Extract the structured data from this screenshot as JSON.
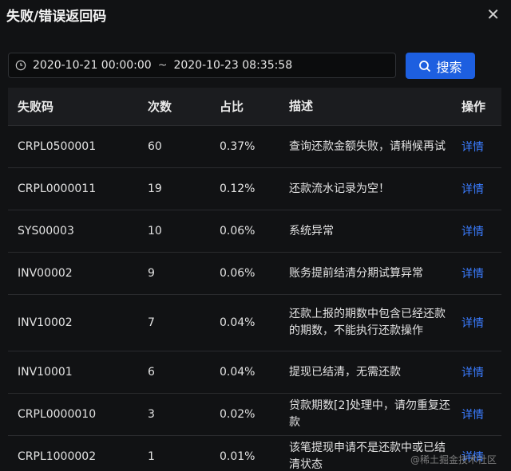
{
  "dialog": {
    "title": "失败/错误返回码",
    "close_icon": "close-icon"
  },
  "filter": {
    "start": "2020-10-21 00:00:00",
    "separator": "~",
    "end": "2020-10-23 08:35:58",
    "search_label": "搜索",
    "search_color": "#1d5fe0"
  },
  "table": {
    "headers": [
      "失败码",
      "次数",
      "占比",
      "描述",
      "操作"
    ],
    "rows": [
      {
        "code": "CRPL0500001",
        "count": "60",
        "ratio": "0.37%",
        "desc": "查询还款金额失败，请稍候再试",
        "action": "详情"
      },
      {
        "code": "CRPL0000011",
        "count": "19",
        "ratio": "0.12%",
        "desc": "还款流水记录为空！",
        "action": "详情"
      },
      {
        "code": "SYS00003",
        "count": "10",
        "ratio": "0.06%",
        "desc": "系统异常",
        "action": "详情"
      },
      {
        "code": "INV00002",
        "count": "9",
        "ratio": "0.06%",
        "desc": "账务提前结清分期试算异常",
        "action": "详情"
      },
      {
        "code": "INV10002",
        "count": "7",
        "ratio": "0.04%",
        "desc": "还款上报的期数中包含已经还款的期数，不能执行还款操作",
        "action": "详情"
      },
      {
        "code": "INV10001",
        "count": "6",
        "ratio": "0.04%",
        "desc": "提现已结清，无需还款",
        "action": "详情"
      },
      {
        "code": "CRPL0000010",
        "count": "3",
        "ratio": "0.02%",
        "desc": "贷款期数[2]处理中，请勿重复还款",
        "action": "详情"
      },
      {
        "code": "CRPL1000002",
        "count": "1",
        "ratio": "0.01%",
        "desc": "该笔提现申请不是还款中或已结清状态",
        "action": "详情"
      }
    ]
  },
  "watermark": "@稀土掘金技术社区"
}
